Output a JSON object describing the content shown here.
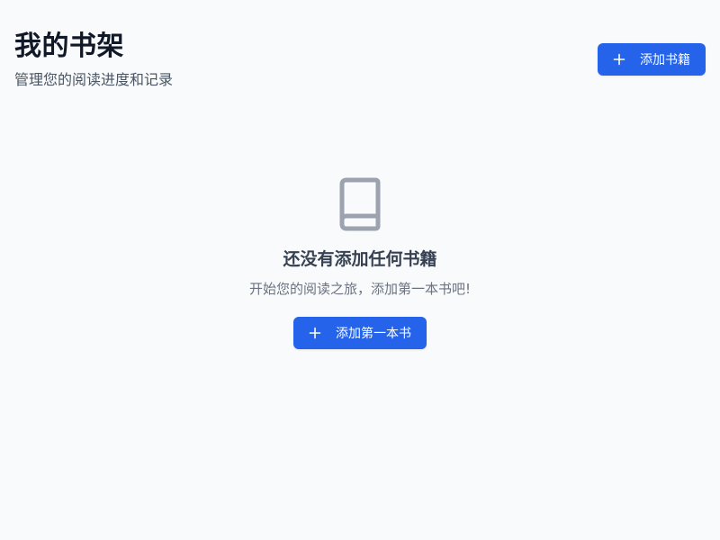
{
  "header": {
    "title": "我的书架",
    "subtitle": "管理您的阅读进度和记录",
    "add_button_label": "添加书籍",
    "add_button_icon": "plus-icon"
  },
  "empty_state": {
    "icon": "book-icon",
    "title": "还没有添加任何书籍",
    "description": "开始您的阅读之旅，添加第一本书吧!",
    "button_label": "添加第一本书",
    "button_icon": "plus-icon"
  },
  "colors": {
    "background": "#f8fafc",
    "primary": "#2563eb",
    "title_text": "#111827",
    "muted_text": "#6b7280",
    "icon": "#9ca3af"
  }
}
